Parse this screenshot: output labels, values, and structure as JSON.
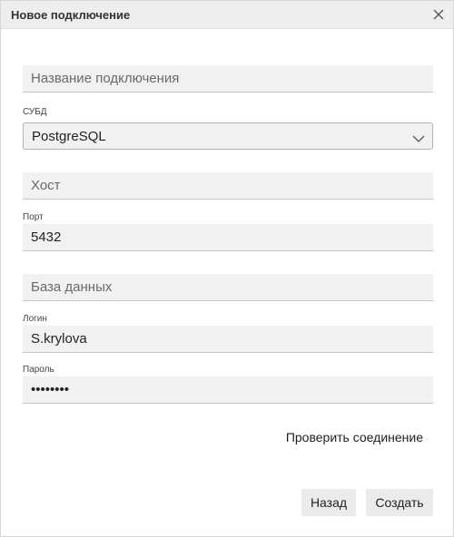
{
  "dialog": {
    "title": "Новое подключение",
    "close_icon": "close-icon"
  },
  "form": {
    "connection_name": {
      "placeholder": "Название подключения",
      "value": ""
    },
    "dbms": {
      "label": "СУБД",
      "value": "PostgreSQL",
      "chevron_icon": "chevron-down-icon"
    },
    "host": {
      "placeholder": "Хост",
      "value": ""
    },
    "port": {
      "label": "Порт",
      "value": "5432"
    },
    "database": {
      "placeholder": "База данных",
      "value": ""
    },
    "login": {
      "label": "Логин",
      "value": "S.krylova"
    },
    "password": {
      "label": "Пароль",
      "value": "********"
    }
  },
  "actions": {
    "test_connection": "Проверить соединение",
    "back": "Назад",
    "create": "Создать"
  }
}
